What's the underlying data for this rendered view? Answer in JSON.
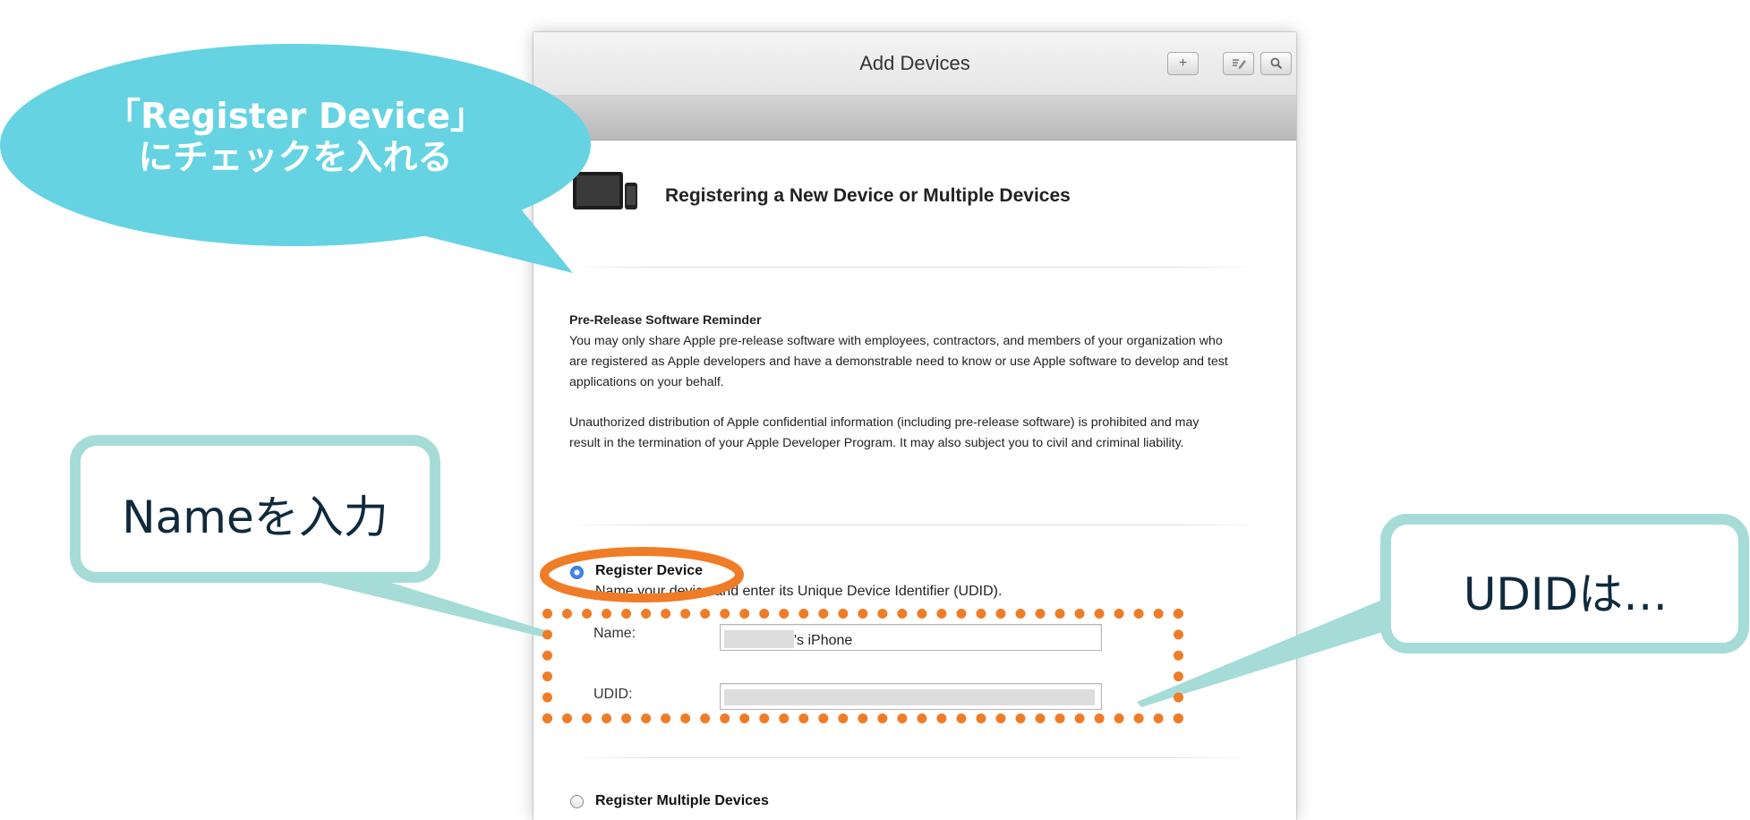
{
  "window": {
    "title": "Add Devices",
    "toolbar_icons": [
      "plus-icon",
      "edit-icon",
      "search-icon"
    ]
  },
  "section": {
    "heading": "Registering a New Device or Multiple Devices",
    "icon": "devices-icon"
  },
  "notice": {
    "title": "Pre-Release Software Reminder",
    "para1": "You may only share Apple pre-release software with employees, contractors, and members of your organization who are registered as Apple developers and have a demonstrable need to know or use Apple software to develop and test applications on your behalf.",
    "para2": "Unauthorized distribution of Apple confidential information (including pre-release software) is prohibited and may result in the termination of your Apple Developer Program. It may also subject you to civil and criminal liability."
  },
  "register_device": {
    "label": "Register Device",
    "selected": true,
    "description": "Name your device and enter its Unique Device Identifier (UDID).",
    "name_label": "Name:",
    "name_value": "'s iPhone",
    "udid_label": "UDID:",
    "udid_value": ""
  },
  "register_multiple": {
    "label": "Register Multiple Devices",
    "selected": false
  },
  "annotations": {
    "bubble_line1": "「Register Device」",
    "bubble_line2": "にチェックを入れる",
    "name_callout": "Nameを入力",
    "udid_callout": "UDIDは…",
    "bubble_color": "#65d3e2",
    "callout_border_color": "#a6dcd7",
    "callout_text_color": "#0f2a3d",
    "highlight_color": "#f07c27"
  }
}
